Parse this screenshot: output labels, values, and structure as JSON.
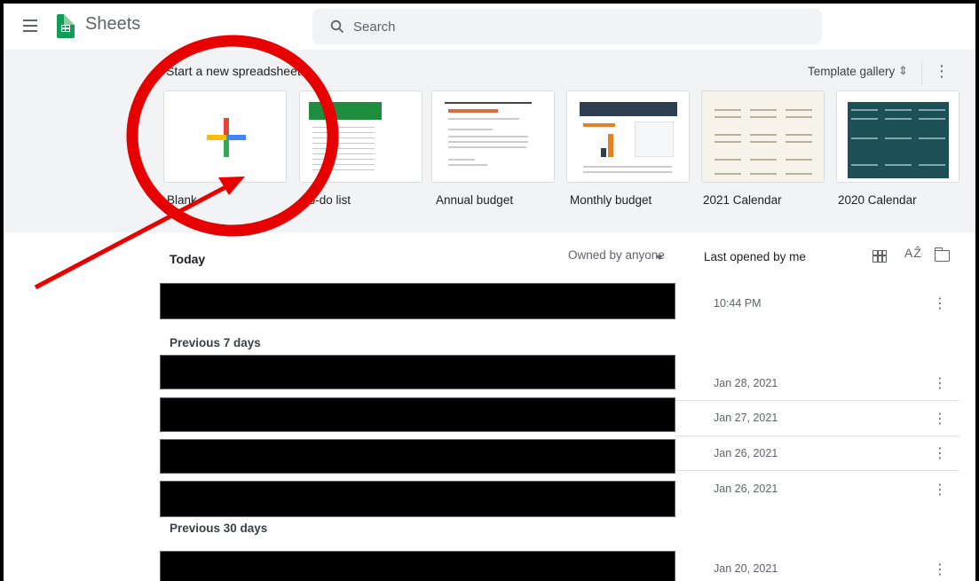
{
  "header": {
    "app_name": "Sheets",
    "search_placeholder": "Search"
  },
  "templates": {
    "title": "Start a new spreadsheet",
    "gallery_label": "Template gallery",
    "items": [
      {
        "label": "Blank"
      },
      {
        "label": "To-do list"
      },
      {
        "label": "Annual budget"
      },
      {
        "label": "Monthly budget"
      },
      {
        "label": "2021 Calendar"
      },
      {
        "label": "2020 Calendar"
      }
    ]
  },
  "files": {
    "section_title": "Today",
    "owner_filter": "Owned by anyone",
    "sort_label": "Last opened by me",
    "groups": [
      {
        "label": "Previous 7 days"
      },
      {
        "label": "Previous 30 days"
      }
    ],
    "rows": [
      {
        "date": "10:44 PM"
      },
      {
        "date": "Jan 28, 2021"
      },
      {
        "date": "Jan 27, 2021"
      },
      {
        "date": "Jan 26, 2021"
      },
      {
        "date": "Jan 26, 2021"
      },
      {
        "date": "Jan 20, 2021"
      }
    ]
  },
  "colors": {
    "annotation": "#e60000",
    "sheets_green": "#0f9d58",
    "band": "#f1f3f4"
  },
  "icons": [
    "menu-icon",
    "sheets-logo-icon",
    "search-icon",
    "sort-arrows-icon",
    "more-vert-icon",
    "grid-view-icon",
    "sort-az-icon",
    "folder-icon"
  ]
}
